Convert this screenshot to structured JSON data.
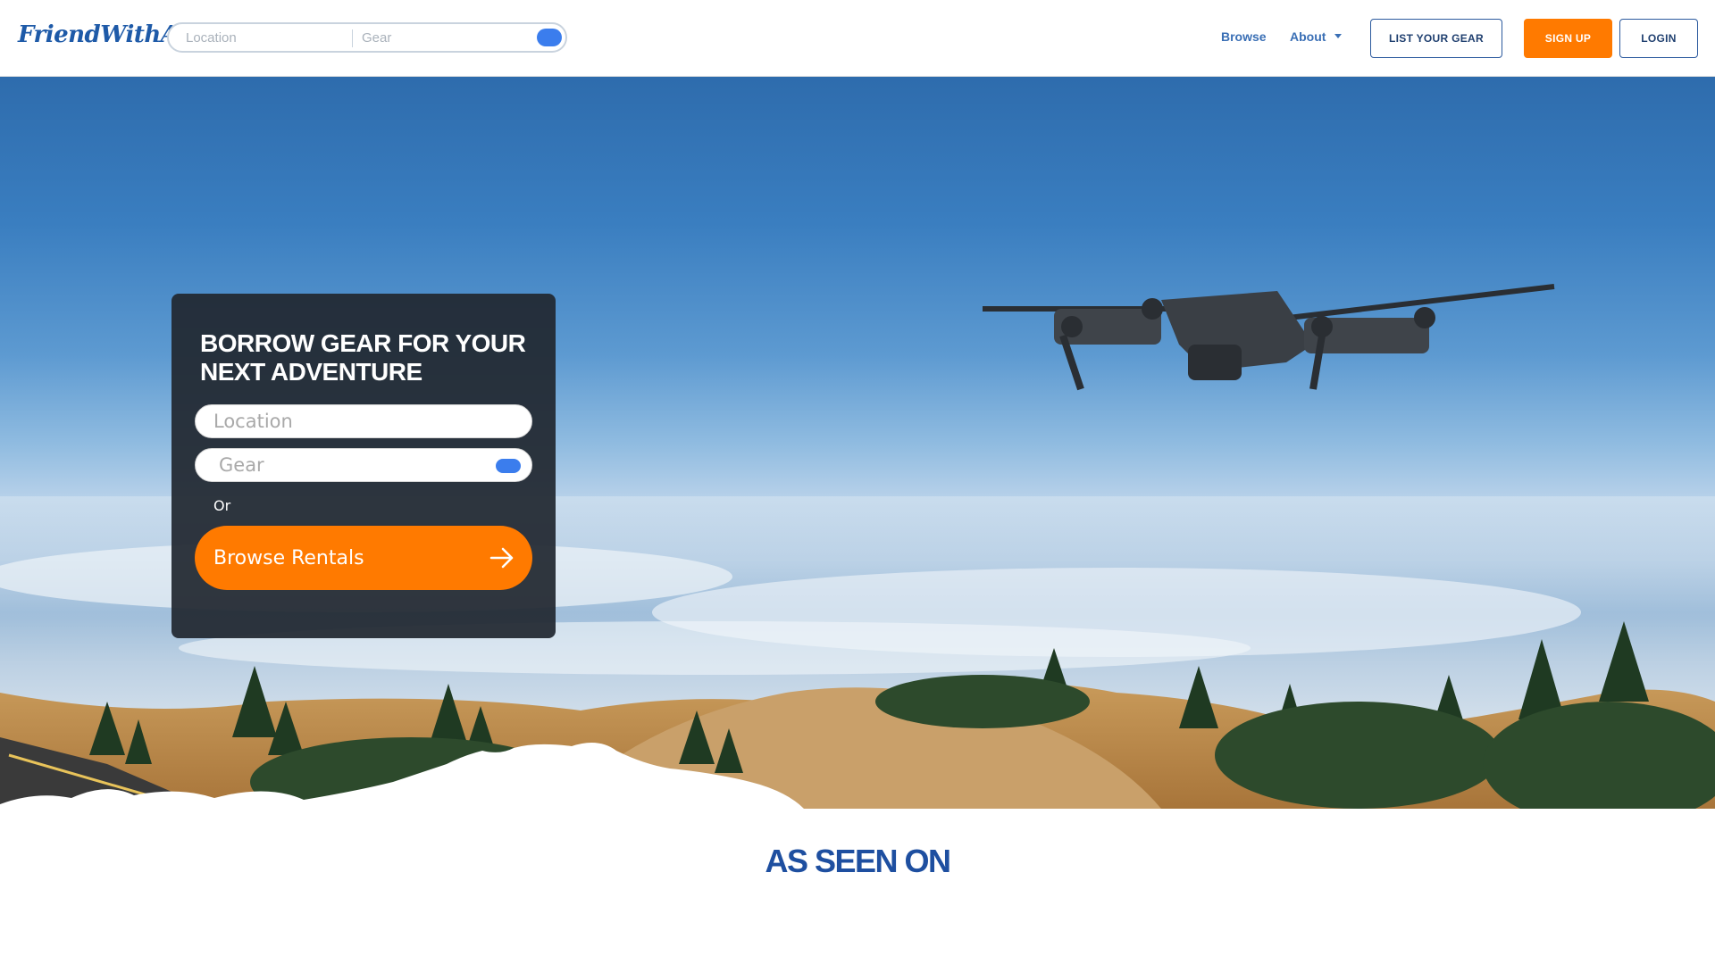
{
  "header": {
    "logo": {
      "name": "FriendWithA",
      "dots": "..."
    },
    "search": {
      "location_placeholder": "Location",
      "gear_placeholder": "Gear"
    },
    "nav": {
      "browse": "Browse",
      "about": "About"
    },
    "buttons": {
      "list_gear": "LIST YOUR GEAR",
      "sign_up": "SIGN UP",
      "login": "LOGIN"
    }
  },
  "hero": {
    "title": "BORROW GEAR FOR YOUR NEXT ADVENTURE",
    "location_placeholder": "Location",
    "gear_placeholder": "Gear",
    "or_text": "Or",
    "cta_label": "Browse Rentals"
  },
  "as_seen_on": {
    "heading": "AS SEEN ON"
  },
  "colors": {
    "brand_blue": "#1e5aa8",
    "accent_orange": "#ff7a00",
    "toggle_blue": "#3b7ded",
    "heading_blue": "#1e4fa0"
  }
}
